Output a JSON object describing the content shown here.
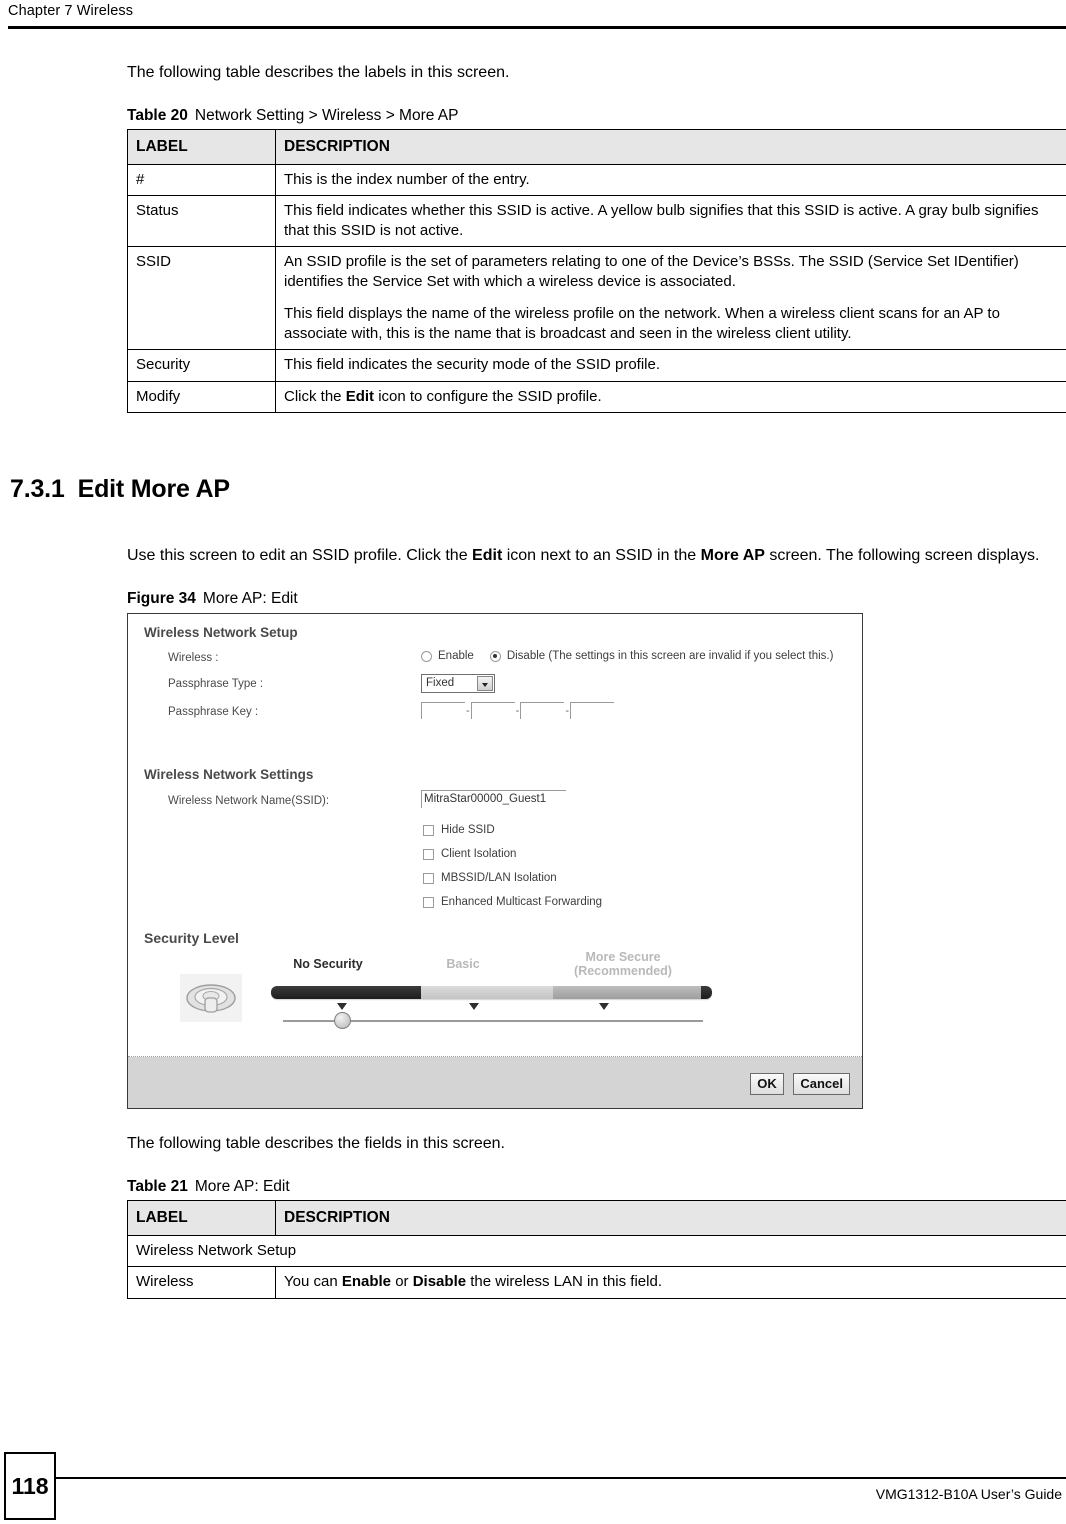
{
  "header": {
    "chapter": "Chapter 7 Wireless"
  },
  "intro_paragraph": "The following table describes the labels in this screen.",
  "table20": {
    "caption_label": "Table 20",
    "caption_title": "Network Setting > Wireless > More AP",
    "headers": {
      "label": "LABEL",
      "description": "DESCRIPTION"
    },
    "rows": [
      {
        "label": "#",
        "description": "This is the index number of the entry."
      },
      {
        "label": "Status",
        "description": "This field indicates whether this SSID is active. A yellow bulb signifies that this SSID is active. A gray bulb signifies that this SSID is not active."
      },
      {
        "label": "SSID",
        "description_p1": "An SSID profile is the set of parameters relating to one of the Device’s BSSs. The SSID (Service Set IDentifier) identifies the Service Set with which a wireless device is associated.",
        "description_p2": "This field displays the name of the wireless profile on the network. When a wireless client scans for an AP to associate with, this is the name that is broadcast and seen in the wireless client utility."
      },
      {
        "label": "Security",
        "description": "This field indicates the security mode of the SSID profile."
      },
      {
        "label": "Modify",
        "description_pre": "Click the ",
        "description_bold": "Edit",
        "description_post": " icon to configure the SSID profile."
      }
    ]
  },
  "section": {
    "number": "7.3.1",
    "title": "Edit More AP",
    "paragraph_pre": "Use this screen to edit an SSID profile. Click the ",
    "paragraph_bold1": "Edit",
    "paragraph_mid": " icon next to an SSID in the ",
    "paragraph_bold2": "More AP",
    "paragraph_post": " screen. The following screen displays."
  },
  "figure": {
    "caption_label": "Figure 34",
    "caption_title": "More AP: Edit",
    "screen": {
      "wireless_network_setup": {
        "title": "Wireless Network Setup",
        "wireless_label": "Wireless :",
        "radio_enable": "Enable",
        "radio_disable": "Disable (The settings in this screen are invalid if you select this.)",
        "selected_radio": "disable",
        "passphrase_type_label": "Passphrase Type :",
        "passphrase_type_value": "Fixed",
        "passphrase_key_label": "Passphrase Key :",
        "passphrase_key_values": [
          "",
          "",
          "",
          ""
        ],
        "passphrase_separator": "-"
      },
      "wireless_network_settings": {
        "title": "Wireless Network Settings",
        "ssid_label": "Wireless Network Name(SSID):",
        "ssid_value": "MitraStar00000_Guest1",
        "checkboxes": [
          {
            "label": "Hide SSID",
            "checked": false
          },
          {
            "label": "Client Isolation",
            "checked": false
          },
          {
            "label": "MBSSID/LAN Isolation",
            "checked": false
          },
          {
            "label": "Enhanced Multicast Forwarding",
            "checked": false
          }
        ]
      },
      "security_level": {
        "title": "Security Level",
        "icon": "wifi-signal-icon",
        "tiers": [
          {
            "label": "No Security",
            "active": true
          },
          {
            "label": "Basic",
            "active": false
          },
          {
            "label": "More Secure\n(Recommended)",
            "line1": "More Secure",
            "line2": "(Recommended)",
            "active": false
          }
        ],
        "selected_tier": "No Security"
      },
      "buttons": {
        "ok": "OK",
        "cancel": "Cancel"
      }
    }
  },
  "mid_paragraph": "The following table describes the fields in this screen.",
  "table21": {
    "caption_label": "Table 21",
    "caption_title": "More AP: Edit",
    "headers": {
      "label": "LABEL",
      "description": "DESCRIPTION"
    },
    "group_row": "Wireless Network Setup",
    "rows": [
      {
        "label": "Wireless",
        "description_pre": "You can ",
        "description_bold1": "Enable",
        "description_mid": " or ",
        "description_bold2": "Disable",
        "description_post": " the wireless LAN in this field."
      }
    ]
  },
  "footer": {
    "page_number": "118",
    "guide_title": "VMG1312-B10A User’s Guide"
  }
}
